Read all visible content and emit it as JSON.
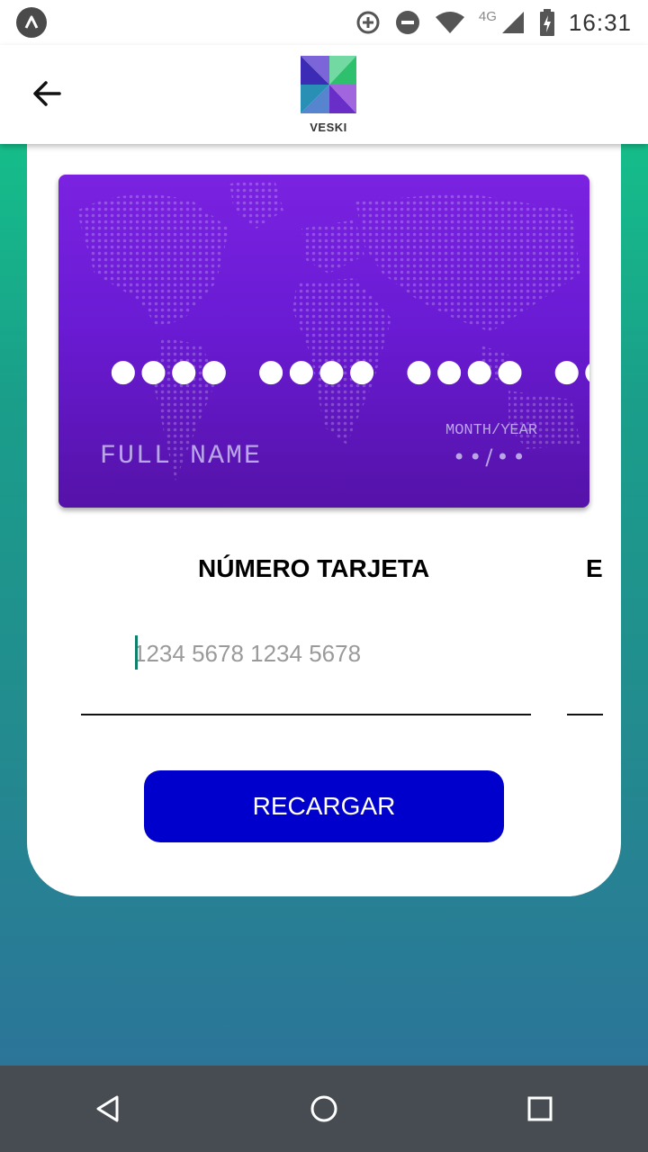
{
  "status_bar": {
    "time": "16:31",
    "network": "4G",
    "icons": [
      "app-a-icon",
      "data-saver-icon",
      "do-not-disturb-icon",
      "wifi-icon",
      "signal-icon",
      "battery-charging-icon"
    ]
  },
  "app_bar": {
    "logo_text": "VESKI",
    "back_icon": "arrow-left-icon"
  },
  "card": {
    "number_mask": "●●●●  ●●●●  ●●●●  ●●●●",
    "name": "FULL NAME",
    "expiry_label": "MONTH/YEAR",
    "expiry_value": "••/••",
    "background_colors": [
      "#7a22e0",
      "#5512a8"
    ]
  },
  "form": {
    "number_label": "NÚMERO TARJETA",
    "number_placeholder": "1234 5678 1234 5678",
    "number_value": "",
    "expiry_label": "EX"
  },
  "actions": {
    "recharge_label": "RECARGAR",
    "recharge_color": "#0000cc"
  },
  "nav_bar": {
    "buttons": [
      "back-triangle-icon",
      "home-circle-icon",
      "recents-square-icon"
    ]
  }
}
